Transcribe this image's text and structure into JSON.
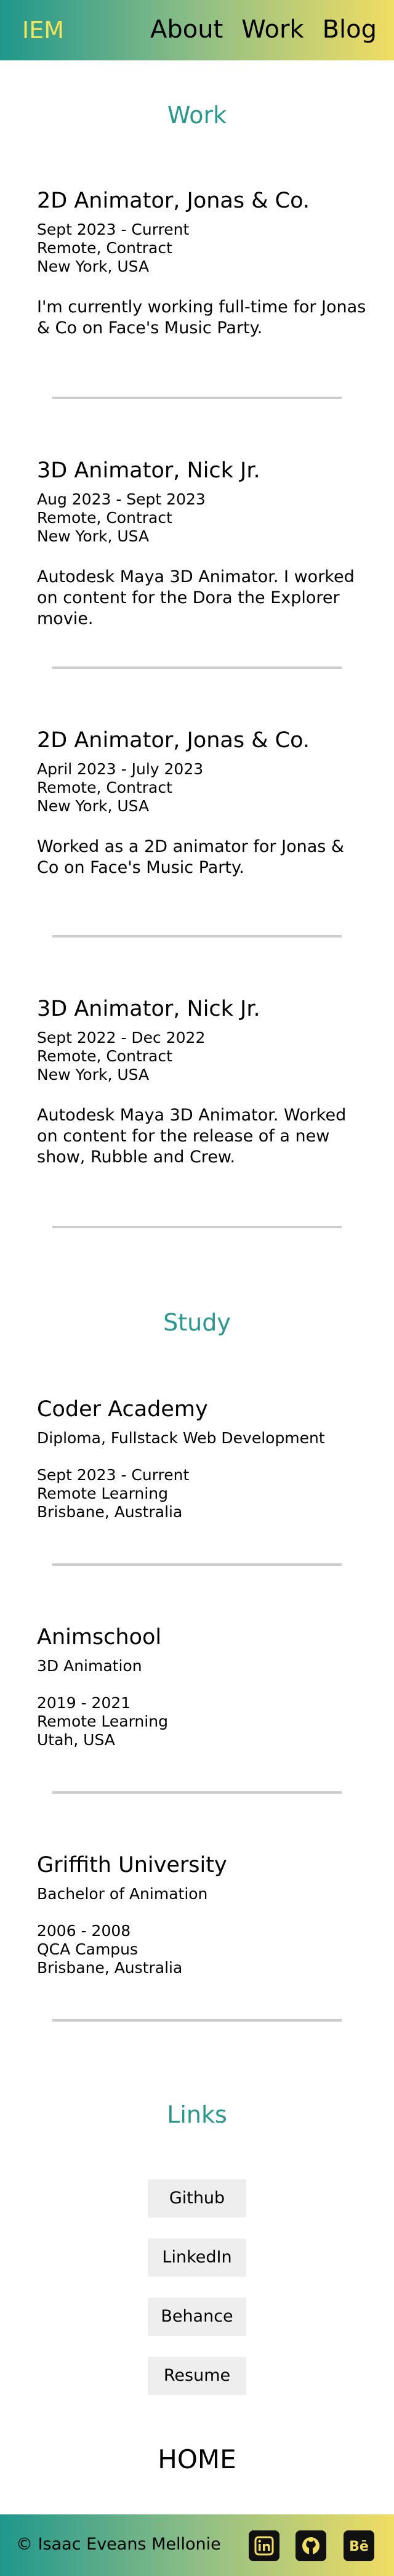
{
  "header": {
    "logo": "IEM",
    "nav": [
      "About",
      "Work",
      "Blog"
    ]
  },
  "work": {
    "title": "Work",
    "entries": [
      {
        "title": "2D Animator, Jonas & Co.",
        "dates": "Sept 2023 - Current",
        "type": "Remote, Contract",
        "location": "New York, USA",
        "description": "I'm currently working full-time for Jonas & Co on Face's Music Party."
      },
      {
        "title": "3D Animator, Nick Jr.",
        "dates": "Aug 2023 - Sept 2023",
        "type": "Remote, Contract",
        "location": "New York, USA",
        "description": "Autodesk Maya 3D Animator. I worked on content for the Dora the Explorer movie."
      },
      {
        "title": "2D Animator, Jonas & Co.",
        "dates": "April 2023 - July 2023",
        "type": "Remote, Contract",
        "location": "New York, USA",
        "description": "Worked as a 2D animator for Jonas & Co on Face's Music Party."
      },
      {
        "title": "3D Animator, Nick Jr.",
        "dates": "Sept 2022 - Dec 2022",
        "type": "Remote, Contract",
        "location": "New York, USA",
        "description": "Autodesk Maya 3D Animator. Worked on content for the release of a new show, Rubble and Crew."
      }
    ]
  },
  "study": {
    "title": "Study",
    "entries": [
      {
        "title": "Coder Academy",
        "qualification": "Diploma, Fullstack Web Development",
        "dates": "Sept 2023 - Current",
        "mode": "Remote Learning",
        "location": "Brisbane, Australia"
      },
      {
        "title": "Animschool",
        "qualification": "3D Animation",
        "dates": "2019 - 2021",
        "mode": "Remote Learning",
        "location": "Utah, USA"
      },
      {
        "title": "Griffith University",
        "qualification": "Bachelor of Animation",
        "dates": "2006 - 2008",
        "mode": "QCA Campus",
        "location": "Brisbane, Australia"
      }
    ]
  },
  "links": {
    "title": "Links",
    "items": [
      "Github",
      "LinkedIn",
      "Behance",
      "Resume"
    ]
  },
  "home": "HOME",
  "footer": {
    "copyright": "© Isaac Eveans Mellonie",
    "social_icons": [
      "linkedin-icon",
      "github-icon",
      "behance-icon"
    ]
  },
  "colors": {
    "gradient_start": "#1f978c",
    "gradient_end": "#f1dd63",
    "logo": "#f4e45a",
    "section_title": "#2a968c",
    "button_bg": "#eeeeee",
    "divider": "#cccccc"
  }
}
